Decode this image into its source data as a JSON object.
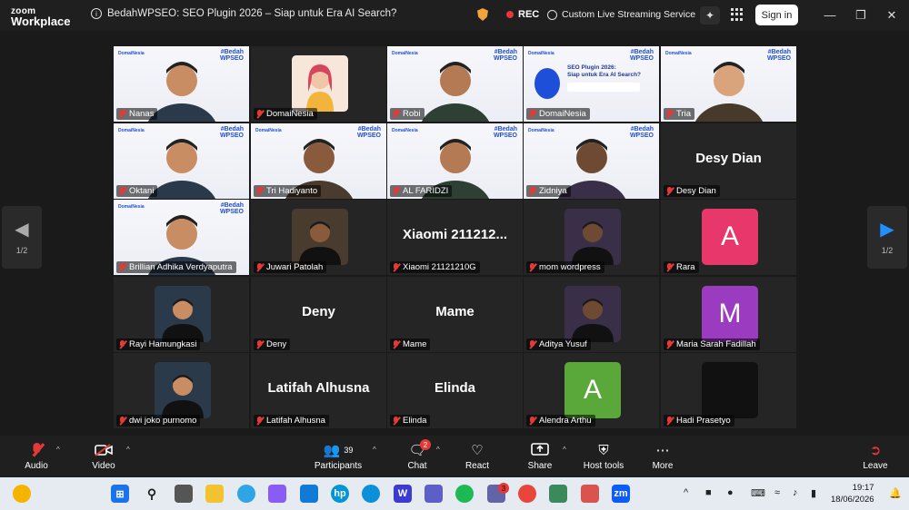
{
  "app": {
    "brand_line1": "zoom",
    "brand_line2": "Workplace"
  },
  "meeting": {
    "title": "BedahWPSEO: SEO Plugin 2026 – Siap untuk Era AI Search?"
  },
  "titlebar": {
    "rec_label": "REC",
    "stream_label": "Custom Live Streaming Service",
    "signin_label": "Sign in",
    "icons": [
      "info-icon",
      "shield-icon",
      "sparkle-icon",
      "apps-grid-icon",
      "minimize-icon",
      "restore-icon",
      "close-icon"
    ]
  },
  "pager": {
    "left_label": "1/2",
    "right_label": "1/2"
  },
  "participants": [
    {
      "name": "Nanas",
      "kind": "video",
      "active": true
    },
    {
      "name": "DomaiNesia",
      "kind": "avatar"
    },
    {
      "name": "Robi",
      "kind": "video"
    },
    {
      "name": "DomaiNesia",
      "kind": "poster"
    },
    {
      "name": "Tria",
      "kind": "video"
    },
    {
      "name": "Oktani",
      "kind": "video"
    },
    {
      "name": "Tri Hadiyanto",
      "kind": "video"
    },
    {
      "name": "AL FARIDZI",
      "kind": "video"
    },
    {
      "name": "Zidniya",
      "kind": "video"
    },
    {
      "name": "Desy Dian",
      "kind": "text",
      "display": "Desy Dian"
    },
    {
      "name": "Brillian Adhika Verdyaputra",
      "kind": "video"
    },
    {
      "name": "Juwari Patolah",
      "kind": "photo"
    },
    {
      "name": "Xiaomi 21121210G",
      "kind": "text",
      "display": "Xiaomi 211212..."
    },
    {
      "name": "mom wordpress",
      "kind": "photo"
    },
    {
      "name": "Rara",
      "kind": "letter",
      "letter": "A",
      "color": "#e8386b"
    },
    {
      "name": "Rayi Hamungkasi",
      "kind": "photo"
    },
    {
      "name": "Deny",
      "kind": "text",
      "display": "Deny"
    },
    {
      "name": "Mame",
      "kind": "text",
      "display": "Mame"
    },
    {
      "name": "Aditya Yusuf",
      "kind": "photo"
    },
    {
      "name": "Maria Sarah Fadillah",
      "kind": "letter",
      "letter": "M",
      "color": "#9b3bc0"
    },
    {
      "name": "dwi joko purnomo",
      "kind": "photo"
    },
    {
      "name": "Latifah Alhusna",
      "kind": "text",
      "display": "Latifah Alhusna"
    },
    {
      "name": "Elinda",
      "kind": "text",
      "display": "Elinda"
    },
    {
      "name": "Alendra Arthu",
      "kind": "letter",
      "letter": "A",
      "color": "#5aa83a"
    },
    {
      "name": "Hadi Prasetyo",
      "kind": "blank"
    }
  ],
  "banner": {
    "hashtag": "#Bedah\nWPSEO",
    "brand": "DomaiNesia",
    "poster_title": "SEO Plugin 2026:\nSiap untuk Era AI Search?"
  },
  "toolbar": {
    "audio": "Audio",
    "video": "Video",
    "participants": "Participants",
    "participants_count": "39",
    "chat": "Chat",
    "chat_badge": "2",
    "react": "React",
    "share": "Share",
    "host_tools": "Host tools",
    "more": "More",
    "leave": "Leave"
  },
  "taskbar": {
    "time": "19:17",
    "date": "18/06/2026",
    "teams_badge": "3"
  }
}
